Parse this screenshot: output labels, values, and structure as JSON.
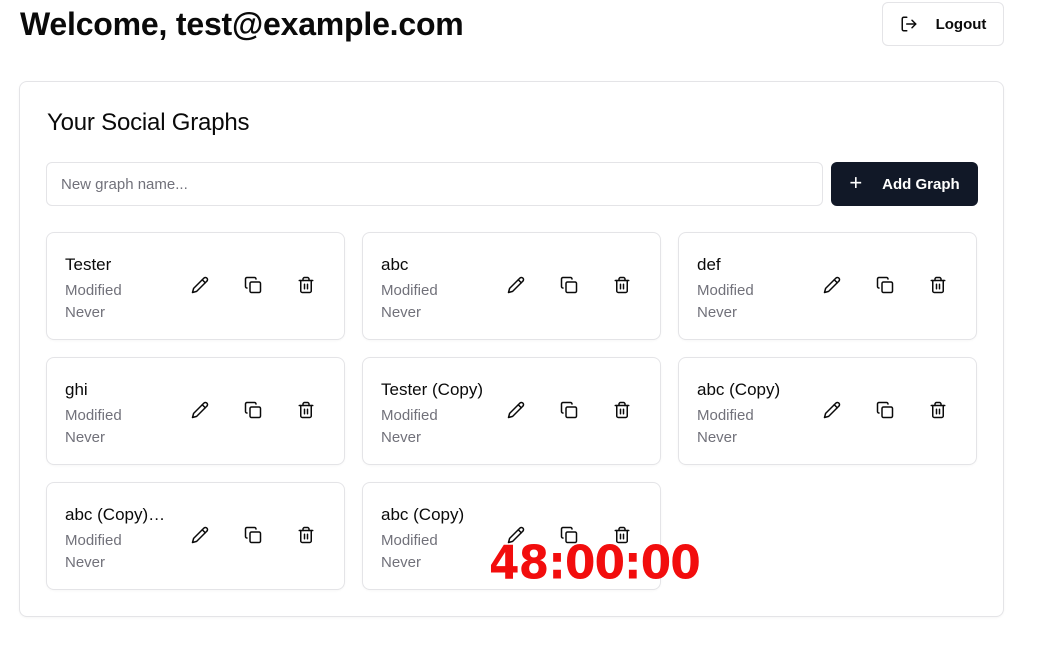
{
  "header": {
    "welcome": "Welcome, test@example.com",
    "logout_label": "Logout"
  },
  "main": {
    "title": "Your Social Graphs",
    "new_graph_placeholder": "New graph name...",
    "new_graph_value": "",
    "add_label": "Add Graph"
  },
  "graphs": [
    {
      "name": "Tester",
      "modified_label": "Modified",
      "modified_value": "Never"
    },
    {
      "name": "abc",
      "modified_label": "Modified",
      "modified_value": "Never"
    },
    {
      "name": "def",
      "modified_label": "Modified",
      "modified_value": "Never"
    },
    {
      "name": "ghi",
      "modified_label": "Modified",
      "modified_value": "Never"
    },
    {
      "name": "Tester (Copy)",
      "modified_label": "Modified",
      "modified_value": "Never"
    },
    {
      "name": "abc (Copy)",
      "modified_label": "Modified",
      "modified_value": "Never"
    },
    {
      "name": "abc (Copy) (Copy)",
      "modified_label": "Modified",
      "modified_value": "Never"
    },
    {
      "name": "abc (Copy)",
      "modified_label": "Modified",
      "modified_value": "Never"
    }
  ],
  "overlay_text": "48:00:00",
  "icons": [
    "logout-icon",
    "plus-icon",
    "pencil-icon",
    "copy-icon",
    "trash-icon"
  ],
  "colors": {
    "primary_button": "#111827",
    "border": "#e4e4e7",
    "muted_text": "#71717a",
    "overlay_red": "#f20d0d"
  }
}
